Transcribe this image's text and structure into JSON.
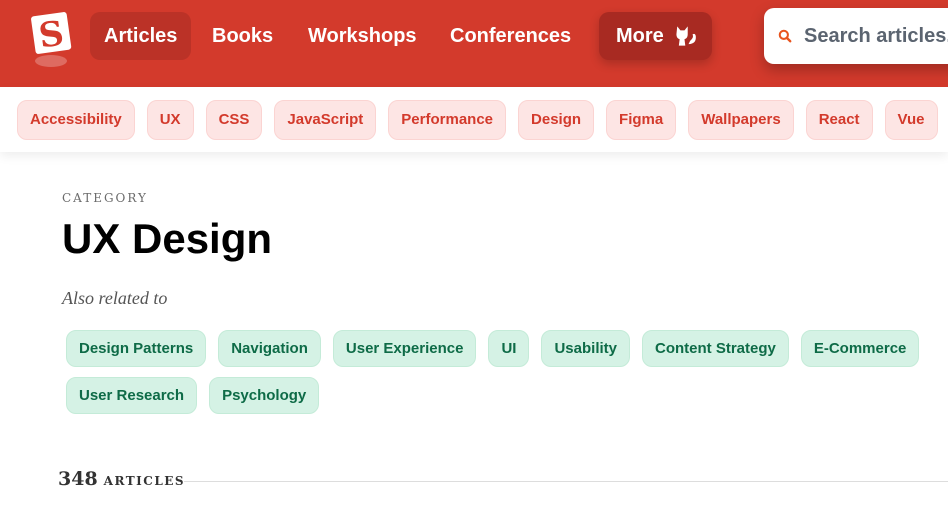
{
  "header": {
    "logo_letter": "S",
    "nav": [
      {
        "label": "Articles",
        "active": true
      },
      {
        "label": "Books"
      },
      {
        "label": "Workshops"
      },
      {
        "label": "Conferences"
      }
    ],
    "more_label": "More",
    "search_placeholder": "Search articles...",
    "brand_color": "#d33a2c"
  },
  "tags": [
    "Accessibility",
    "UX",
    "CSS",
    "JavaScript",
    "Performance",
    "Design",
    "Figma",
    "Wallpapers",
    "React",
    "Vue"
  ],
  "main": {
    "category_label": "CATEGORY",
    "title": "UX Design",
    "related_label": "Also related to",
    "related": [
      "Design Patterns",
      "Navigation",
      "User Experience",
      "UI",
      "Usability",
      "Content Strategy",
      "E-Commerce",
      "User Research",
      "Psychology"
    ],
    "article_count": "348",
    "article_count_label": "ARTICLES"
  }
}
